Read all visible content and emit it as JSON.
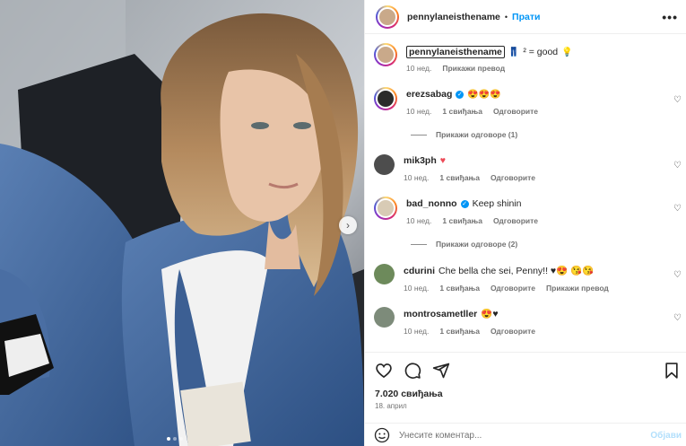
{
  "post": {
    "author": "pennylaneisthename",
    "separator": "•",
    "follow_label": "Прати",
    "more_icon": "more-horizontal-icon",
    "photo": {
      "carousel_dots": 3,
      "active_dot": 0,
      "next_icon": "chevron-right-icon"
    }
  },
  "caption": {
    "username": "pennylaneisthename",
    "emoji_1": "👖",
    "text": "² = good",
    "emoji_2": "💡",
    "time": "10 нед.",
    "translate": "Прикажи превод"
  },
  "comments": [
    {
      "username": "erezsabag",
      "verified": true,
      "text": "😍😍😍",
      "time": "10 нед.",
      "likes": "1 свиђања",
      "reply": "Одговорите",
      "replies_label": "Прикажи одговоре (1)"
    },
    {
      "username": "mik3ph",
      "verified": false,
      "text": "♥",
      "time": "10 нед.",
      "likes": "1 свиђања",
      "reply": "Одговорите"
    },
    {
      "username": "bad_nonno",
      "verified": true,
      "text": "Keep shinin",
      "time": "10 нед.",
      "likes": "1 свиђања",
      "reply": "Одговорите",
      "replies_label": "Прикажи одговоре (2)"
    },
    {
      "username": "cdurini",
      "verified": false,
      "text": "Che bella che sei, Penny!! ♥😍 😘😘",
      "time": "10 нед.",
      "likes": "1 свиђања",
      "reply": "Одговорите",
      "translate": "Прикажи превод"
    },
    {
      "username": "montrosametller",
      "verified": false,
      "text": "😍♥",
      "time": "10 нед.",
      "likes": "1 свиђања",
      "reply": "Одговорите"
    }
  ],
  "actions": {
    "likes": "7.020 свиђања",
    "date": "18. април",
    "comment_placeholder": "Унесите коментар...",
    "post_label": "Објави"
  },
  "colors": {
    "accent": "#0095f6",
    "text": "#262626",
    "muted": "#737373",
    "heart_red": "#ed4956"
  }
}
